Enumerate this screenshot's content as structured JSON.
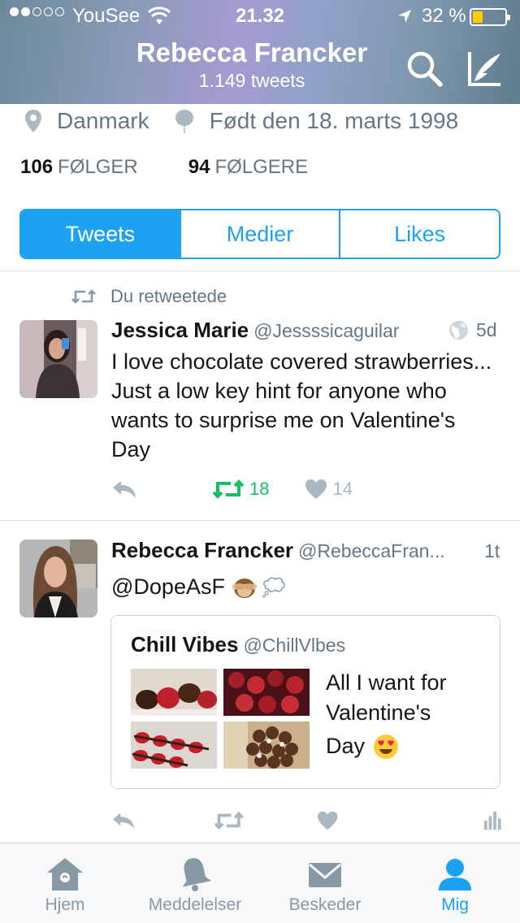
{
  "status_bar": {
    "carrier": "YouSee",
    "time": "21.32",
    "battery": "32 %",
    "battery_level": 0.32
  },
  "header": {
    "name": "Rebecca Francker",
    "tweet_count": "1.149 tweets"
  },
  "profile": {
    "location": "Danmark",
    "birthday": "Født den 18. marts 1998",
    "following_count": "106",
    "following_label": "FØLGER",
    "followers_count": "94",
    "followers_label": "FØLGERE"
  },
  "tabs": {
    "tweets": "Tweets",
    "media": "Medier",
    "likes": "Likes"
  },
  "tweets": [
    {
      "retweet_note": "Du retweetede",
      "name": "Jessica Marie",
      "handle": "@Jessssicaguilar",
      "time": "5d",
      "text": "I love chocolate covered strawberries... Just a low key hint for anyone who wants to surprise me on Valentine's Day",
      "retweets": "18",
      "likes": "14"
    },
    {
      "name": "Rebecca Francker",
      "handle": "@RebeccaFran...",
      "time": "1t",
      "text": "@DopeAsF",
      "quote": {
        "name": "Chill Vibes",
        "handle": "@ChillVlbes",
        "text_line1": "All I want for",
        "text_line2": "Valentine's",
        "text_line3": "Day"
      }
    }
  ],
  "tab_bar": {
    "home": "Hjem",
    "notifications": "Meddelelser",
    "messages": "Beskeder",
    "me": "Mig"
  },
  "colors": {
    "accent": "#1da1f2",
    "retweet_green": "#17bf63",
    "muted": "#657786",
    "icon_gray": "#aab8c2"
  }
}
